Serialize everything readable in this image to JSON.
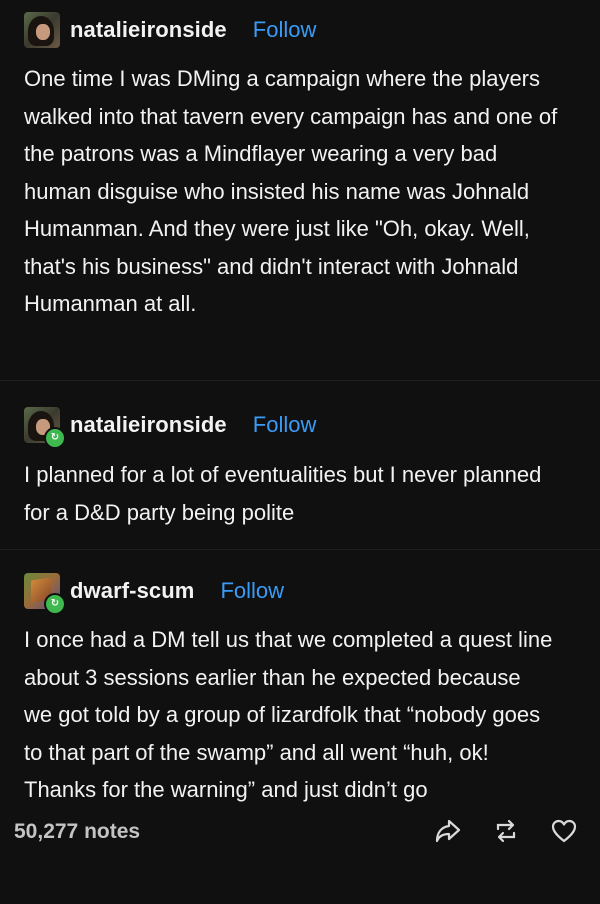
{
  "posts": [
    {
      "username": "natalieironside",
      "follow_label": "Follow",
      "text": "One time I was DMing a campaign where the players walked into that tavern every campaign has and one of the patrons was a Mindflayer wearing a very bad human disguise who insisted his name was Johnald Humanman. And they were just like \"Oh, okay.  Well, that's his business\" and didn't interact with Johnald Humanman at all."
    },
    {
      "username": "natalieironside",
      "follow_label": "Follow",
      "text": "I planned for a lot of eventualities but I never planned for a D&D party being polite"
    },
    {
      "username": "dwarf-scum",
      "follow_label": "Follow",
      "text": "I once had a DM tell us that we completed a quest line about 3 sessions earlier than he expected because we got told by a group of lizardfolk that “nobody goes to that part of the swamp” and all went “huh, ok! Thanks for the warning” and just didn’t go"
    }
  ],
  "footer": {
    "notes": "50,277 notes",
    "icons": [
      "share-icon",
      "reblog-icon",
      "heart-icon"
    ]
  },
  "colors": {
    "background": "#101010",
    "text": "#f2f2f2",
    "follow": "#3a9bf7",
    "reblog_badge": "#3fb94f",
    "notes": "#c4c4c4"
  }
}
